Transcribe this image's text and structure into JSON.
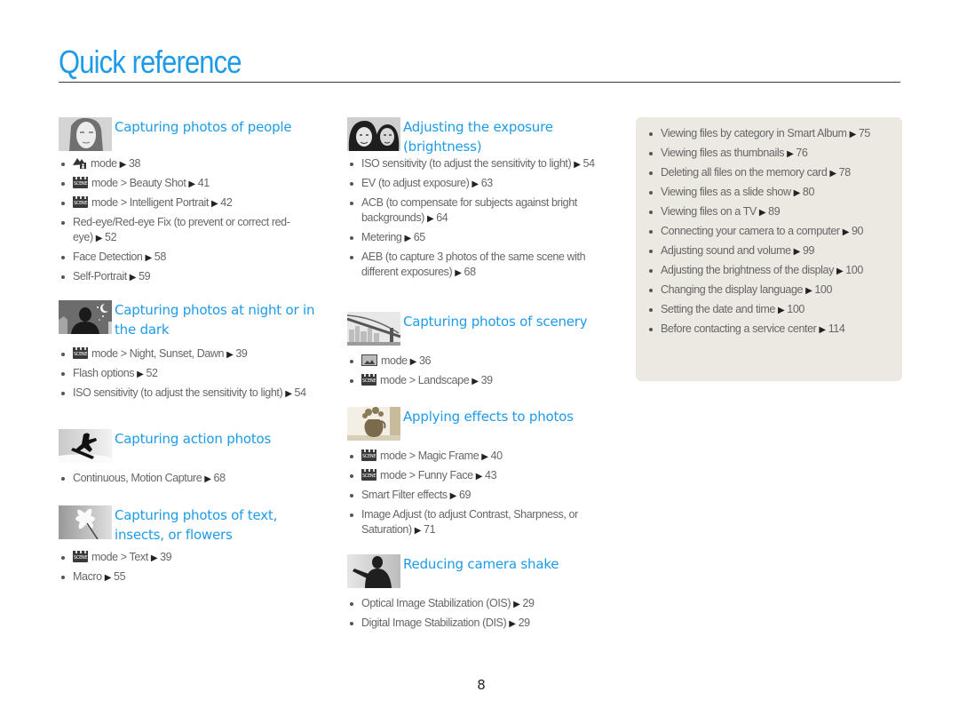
{
  "page": {
    "title": "Quick reference",
    "page_number": "8",
    "arrow_glyph": "▶"
  },
  "colors": {
    "accent": "#1e9be8",
    "body_text": "#666666",
    "panel_bg": "#ece9e2"
  },
  "left_column": {
    "sections": [
      {
        "title": "Capturing photos of people",
        "thumbnail": "woman-portrait-thumbnail",
        "items": [
          {
            "icon": "smart-auto-mode-icon",
            "text": "mode",
            "page": "38"
          },
          {
            "icon": "scene-mode-icon",
            "text": "mode > Beauty Shot",
            "page": "41"
          },
          {
            "icon": "scene-mode-icon",
            "text": "mode > Intelligent Portrait",
            "page": "42"
          },
          {
            "icon": "",
            "text": "Red-eye/Red-eye Fix (to prevent or correct red-eye)",
            "page": "52"
          },
          {
            "icon": "",
            "text": "Face Detection",
            "page": "58"
          },
          {
            "icon": "",
            "text": "Self-Portrait",
            "page": "59"
          }
        ]
      },
      {
        "title": "Capturing photos at night or in the dark",
        "thumbnail": "night-silhouette-thumbnail",
        "items": [
          {
            "icon": "scene-mode-icon",
            "text": "mode > Night, Sunset, Dawn",
            "page": "39"
          },
          {
            "icon": "",
            "text": "Flash options",
            "page": "52"
          },
          {
            "icon": "",
            "text": "ISO sensitivity (to adjust the sensitivity to light)",
            "page": "54"
          }
        ]
      },
      {
        "title": "Capturing action photos",
        "thumbnail": "snowboarder-thumbnail",
        "items": [
          {
            "icon": "",
            "text": "Continuous, Motion Capture",
            "page": "68"
          }
        ]
      },
      {
        "title": "Capturing photos of text, insects, or flowers",
        "thumbnail": "flower-thumbnail",
        "items": [
          {
            "icon": "scene-mode-icon",
            "text": "mode > Text",
            "page": "39"
          },
          {
            "icon": "",
            "text": "Macro",
            "page": "55"
          }
        ]
      }
    ]
  },
  "middle_column": {
    "sections": [
      {
        "title": "Adjusting the exposure (brightness)",
        "thumbnail": "couple-portrait-thumbnail",
        "items": [
          {
            "icon": "",
            "text": "ISO sensitivity (to adjust the sensitivity to light)",
            "page": "54"
          },
          {
            "icon": "",
            "text": "EV (to adjust exposure)",
            "page": "63"
          },
          {
            "icon": "",
            "text": "ACB (to compensate for subjects against bright backgrounds)",
            "page": "64"
          },
          {
            "icon": "",
            "text": "Metering",
            "page": "65"
          },
          {
            "icon": "",
            "text": "AEB (to capture 3 photos of the same scene with different exposures)",
            "page": "68"
          }
        ]
      },
      {
        "title": "Capturing photos of scenery",
        "thumbnail": "bridge-thumbnail",
        "items": [
          {
            "icon": "landscape-mode-icon",
            "text": "mode",
            "page": "36"
          },
          {
            "icon": "scene-mode-icon",
            "text": "mode > Landscape",
            "page": "39"
          }
        ]
      },
      {
        "title": "Applying effects to photos",
        "thumbnail": "vase-thumbnail",
        "items": [
          {
            "icon": "scene-mode-icon",
            "text": "mode > Magic Frame",
            "page": "40"
          },
          {
            "icon": "scene-mode-icon",
            "text": "mode > Funny Face",
            "page": "43"
          },
          {
            "icon": "",
            "text": "Smart Filter effects",
            "page": "69"
          },
          {
            "icon": "",
            "text": "Image Adjust (to adjust Contrast, Sharpness, or Saturation)",
            "page": "71"
          }
        ]
      },
      {
        "title": "Reducing camera shake",
        "thumbnail": "waving-person-thumbnail",
        "items": [
          {
            "icon": "",
            "text": "Optical Image Stabilization (OIS)",
            "page": "29"
          },
          {
            "icon": "",
            "text": "Digital Image Stabilization (DIS)",
            "page": "29"
          }
        ]
      }
    ]
  },
  "right_panel": {
    "items": [
      {
        "text": "Viewing files by category in Smart Album",
        "page": "75"
      },
      {
        "text": "Viewing files as thumbnails",
        "page": "76"
      },
      {
        "text": "Deleting all files on the memory card",
        "page": "78"
      },
      {
        "text": "Viewing files as a slide show",
        "page": "80"
      },
      {
        "text": "Viewing files on a TV",
        "page": "89"
      },
      {
        "text": "Connecting your camera to a computer",
        "page": "90"
      },
      {
        "text": "Adjusting sound and volume",
        "page": "99"
      },
      {
        "text": "Adjusting the brightness of the display",
        "page": "100"
      },
      {
        "text": "Changing the display language",
        "page": "100"
      },
      {
        "text": "Setting the date and time",
        "page": "100"
      },
      {
        "text": "Before contacting a service center",
        "page": "114"
      }
    ]
  }
}
